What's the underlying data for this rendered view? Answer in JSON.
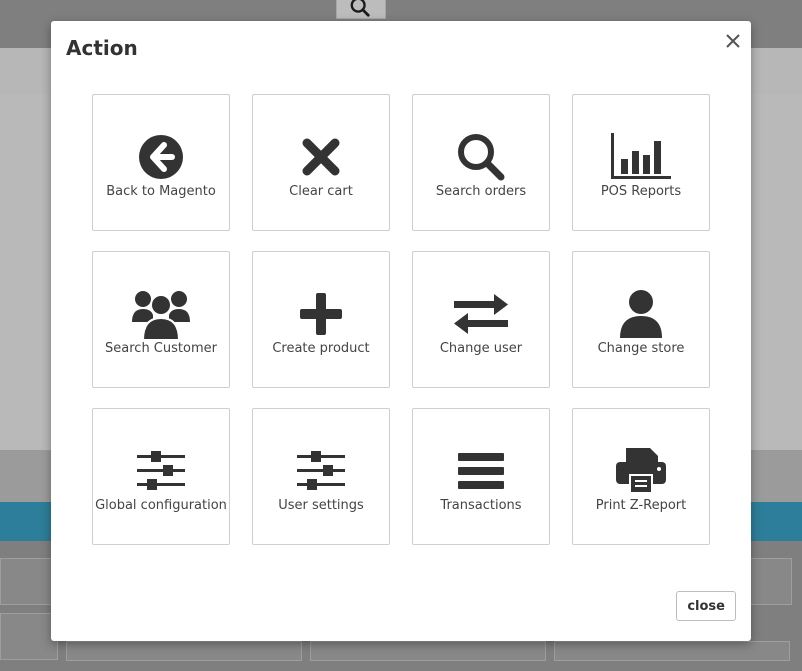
{
  "modal": {
    "title": "Action",
    "close_label": "close",
    "tiles": [
      {
        "label": "Back to Magento",
        "icon": "arrow-left-circle-icon"
      },
      {
        "label": "Clear cart",
        "icon": "times-icon"
      },
      {
        "label": "Search orders",
        "icon": "search-icon"
      },
      {
        "label": "POS Reports",
        "icon": "bar-chart-icon"
      },
      {
        "label": "Search Customer",
        "icon": "users-icon"
      },
      {
        "label": "Create product",
        "icon": "plus-icon"
      },
      {
        "label": "Change user",
        "icon": "exchange-icon"
      },
      {
        "label": "Change store",
        "icon": "user-icon"
      },
      {
        "label": "Global configuration",
        "icon": "sliders-icon"
      },
      {
        "label": "User settings",
        "icon": "sliders-icon"
      },
      {
        "label": "Transactions",
        "icon": "list-bars-icon"
      },
      {
        "label": "Print Z-Report",
        "icon": "printer-icon"
      }
    ]
  },
  "colors": {
    "icon": "#333333",
    "text": "#444444",
    "border": "#cfcfcf",
    "accent_blue": "#2d7e9a"
  }
}
